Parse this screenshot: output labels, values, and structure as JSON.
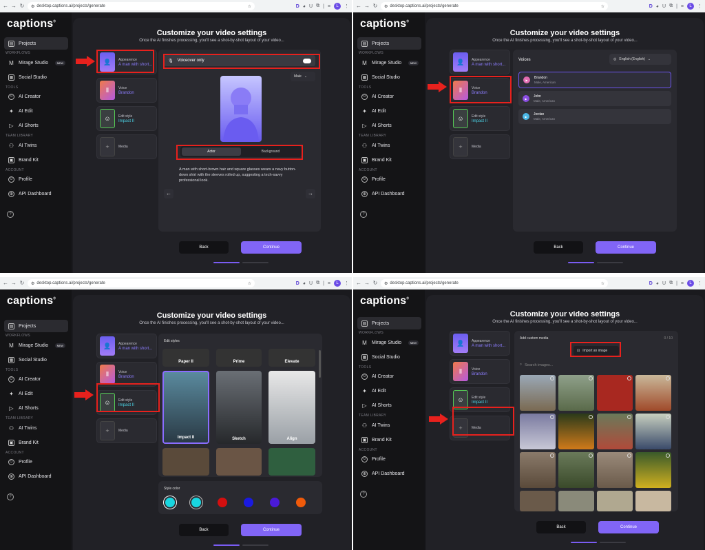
{
  "browser": {
    "url": "desktop.captions.ai/projects/generate",
    "ext_d": "D",
    "ext_u": "U",
    "avatar": "L"
  },
  "sidebar": {
    "logo": "captions",
    "projects": "Projects",
    "workflows_head": "WORKFLOWS",
    "mirage": "Mirage Studio",
    "new_badge": "NEW",
    "social": "Social Studio",
    "tools_head": "TOOLS",
    "ai_creator": "AI Creator",
    "ai_edit": "AI Edit",
    "ai_shorts": "AI Shorts",
    "team_head": "TEAM LIBRARY",
    "ai_twins": "AI Twins",
    "brand_kit": "Brand Kit",
    "account_head": "ACCOUNT",
    "profile": "Profile",
    "api": "API Dashboard",
    "help": "?"
  },
  "main": {
    "title": "Customize your video settings",
    "subtitle": "Once the AI finishes processing, you'll see a shot-by-shot layout of your video...",
    "back": "Back",
    "continue": "Continue"
  },
  "steps": {
    "appearance_label": "Appearence",
    "appearance_value": "A man with short...",
    "voice_label": "Voice",
    "voice_value": "Brandon",
    "edit_label": "Edit style",
    "edit_value": "Impact II",
    "media_label": "Media"
  },
  "appearance": {
    "voiceover": "Voiceover only",
    "gender": "Male",
    "tab_actor": "Actor",
    "tab_background": "Background",
    "description": "A man with short-brown hair and square glasses wears a navy button-down shirt with the sleeves rolled up, suggesting a tech-savvy professional look."
  },
  "voices": {
    "heading": "Voices",
    "language": "English (English)",
    "list": [
      {
        "name": "Brandon",
        "desc": "Male, American",
        "color": "#e06bb0"
      },
      {
        "name": "John",
        "desc": "Male, American",
        "color": "#8a4de0"
      },
      {
        "name": "Jordan",
        "desc": "Male, American",
        "color": "#4bb8e6"
      }
    ]
  },
  "edit": {
    "heading": "Edit styles",
    "top_row": [
      "Paper II",
      "Prime",
      "Elevate"
    ],
    "mid_row": [
      "Impact II",
      "Sketch",
      "Align"
    ],
    "style_color": "Style color",
    "colors": [
      "#19d6e0",
      "#19d6e0",
      "#d40f0f",
      "#1a1ae0",
      "#4a1ad8",
      "#f05a0a"
    ]
  },
  "media": {
    "heading": "Add custom media",
    "count": "0 / 10",
    "import": "Import an image",
    "search_placeholder": "Search images..."
  }
}
